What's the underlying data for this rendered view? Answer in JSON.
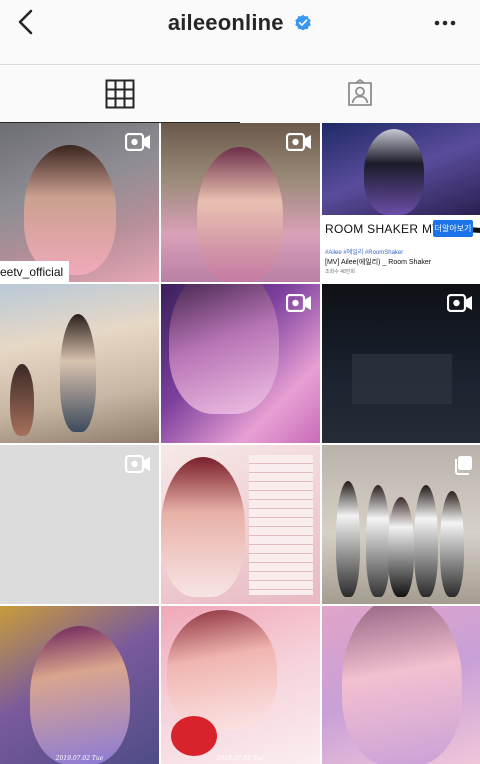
{
  "header": {
    "username": "aileeonline",
    "back_icon": "chevron-left-icon",
    "verified_icon": "verified-badge-icon",
    "more_icon": "more-options-icon",
    "verified_color": "#3897f0"
  },
  "tabs": [
    {
      "name": "grid",
      "icon": "grid-icon",
      "active": true
    },
    {
      "name": "tagged",
      "icon": "tagged-icon",
      "active": false
    }
  ],
  "posts": [
    {
      "type": "video",
      "tag_label": "eetv_official"
    },
    {
      "type": "video"
    },
    {
      "type": "image",
      "yt_title": "ROOM SHAKER MV",
      "yt_button": "더알아보기",
      "yt_tags": "#Ailee #에일리 #RoomShaker",
      "yt_subtitle": "[MV] Ailee(에일리) _ Room Shaker",
      "yt_views": "조회수 48만회"
    },
    {
      "type": "image"
    },
    {
      "type": "video"
    },
    {
      "type": "video"
    },
    {
      "type": "video"
    },
    {
      "type": "image"
    },
    {
      "type": "carousel"
    },
    {
      "type": "image",
      "stamp": "2019.07.02 Tue"
    },
    {
      "type": "image",
      "stamp": "2019.07.02 Tue"
    },
    {
      "type": "image"
    }
  ]
}
